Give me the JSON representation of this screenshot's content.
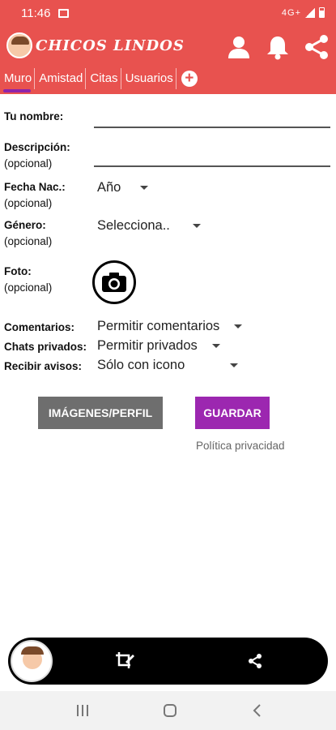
{
  "status_bar": {
    "time": "11:46",
    "network": "4G+"
  },
  "app": {
    "title": "CHICOS LINDOS"
  },
  "tabs": [
    {
      "label": "Muro",
      "active": true
    },
    {
      "label": "Amistad",
      "active": false
    },
    {
      "label": "Citas",
      "active": false
    },
    {
      "label": "Usuarios",
      "active": false
    }
  ],
  "form": {
    "name_label": "Tu nombre:",
    "name_value": "",
    "desc_label": "Descripción:",
    "desc_optional": "(opcional)",
    "desc_value": "",
    "birth_label": "Fecha Nac.:",
    "birth_optional": "(opcional)",
    "birth_value": "Año",
    "gender_label": "Género:",
    "gender_optional": "(opcional)",
    "gender_value": "Selecciona..",
    "photo_label": "Foto:",
    "photo_optional": "(opcional)",
    "comments_label": "Comentarios:",
    "comments_value": "Permitir comentarios",
    "chats_label": "Chats privados:",
    "chats_value": "Permitir privados",
    "notices_label": "Recibir avisos:",
    "notices_value": "Sólo con icono"
  },
  "actions": {
    "images_profile": "IMÁGENES/PERFIL",
    "save": "GUARDAR",
    "privacy": "Política privacidad"
  },
  "colors": {
    "primary": "#e8524f",
    "accent": "#9c27b0",
    "grey_button": "#6e6e6e"
  },
  "icons": {
    "app_bar": [
      "person-icon",
      "bell-icon",
      "share-icon"
    ],
    "bottom_bar": [
      "avatar",
      "crop-edit-icon",
      "share-icon"
    ],
    "nav": [
      "recents-icon",
      "home-icon",
      "back-icon"
    ]
  }
}
